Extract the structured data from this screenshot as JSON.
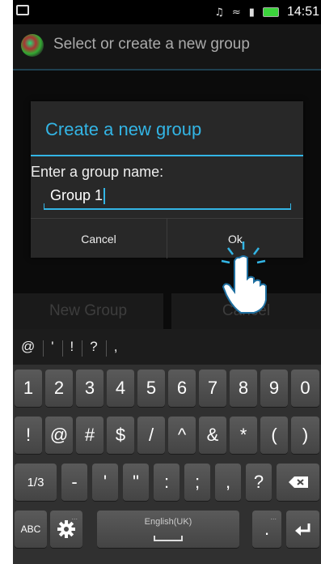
{
  "status_bar": {
    "time": "14:51"
  },
  "action_bar": {
    "title": "Select or create a new group"
  },
  "background_buttons": {
    "new_group": "New Group",
    "cancel": "Cancel"
  },
  "dialog": {
    "title": "Create a new group",
    "label": "Enter a group name:",
    "input_value": "Group 1",
    "cancel": "Cancel",
    "ok": "Ok"
  },
  "keyboard": {
    "suggestions": [
      "@",
      "'",
      "!",
      "?",
      ","
    ],
    "row1": [
      "1",
      "2",
      "3",
      "4",
      "5",
      "6",
      "7",
      "8",
      "9",
      "0"
    ],
    "row2": [
      "!",
      "@",
      "#",
      "$",
      "/",
      "^",
      "&",
      "*",
      "(",
      ")"
    ],
    "row3": {
      "mode": "1/3",
      "keys": [
        "-",
        "'",
        "\"",
        ":",
        ";",
        ",",
        "?"
      ],
      "backspace_icon": "backspace-icon"
    },
    "row4": {
      "abc": "ABC",
      "settings_icon": "gear-icon",
      "space_label": "English(UK)",
      "period": ".",
      "period_sub": "...",
      "settings_sub": "...",
      "enter_icon": "enter-icon"
    }
  },
  "colors": {
    "accent": "#33b5e5",
    "battery": "#3cd43c"
  }
}
